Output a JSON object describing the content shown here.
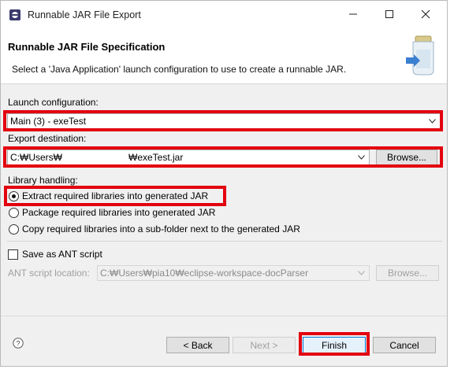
{
  "window": {
    "title": "Runnable JAR File Export",
    "minimize_icon": "minimize-icon",
    "maximize_icon": "maximize-icon",
    "close_icon": "close-icon"
  },
  "banner": {
    "heading": "Runnable JAR File Specification",
    "description": "Select a 'Java Application' launch configuration to use to create a runnable JAR."
  },
  "launch": {
    "label": "Launch configuration:",
    "value": "Main (3) - exeTest"
  },
  "export": {
    "label": "Export destination:",
    "path_prefix": "C:₩Users₩",
    "path_suffix": "₩exeTest.jar",
    "browse_label": "Browse..."
  },
  "library": {
    "label": "Library handling:",
    "options": [
      {
        "label": "Extract required libraries into generated JAR",
        "checked": true
      },
      {
        "label": "Package required libraries into generated JAR",
        "checked": false
      },
      {
        "label": "Copy required libraries into a sub-folder next to the generated JAR",
        "checked": false
      }
    ]
  },
  "ant": {
    "checkbox_label": "Save as ANT script",
    "location_label": "ANT script location:",
    "location_value": "C:₩Users₩pia10₩eclipse-workspace-docParser",
    "browse_label": "Browse..."
  },
  "footer": {
    "help_icon": "help-icon",
    "back_label": "< Back",
    "next_label": "Next >",
    "finish_label": "Finish",
    "cancel_label": "Cancel"
  },
  "colors": {
    "highlight": "#e3000f",
    "dialog_bg": "#f0f0f0"
  }
}
